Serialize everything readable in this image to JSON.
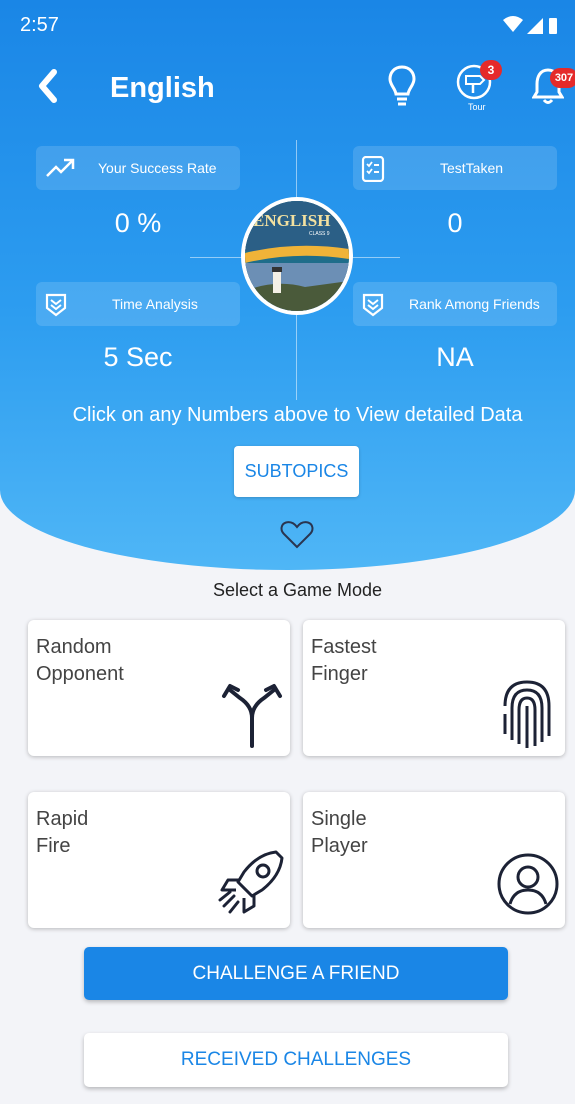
{
  "status": {
    "time": "2:57"
  },
  "header": {
    "title": "English",
    "tour_label": "Tour",
    "tour_badge": "3",
    "notification_badge": "307"
  },
  "stats": {
    "success_rate": {
      "label": "Your Success Rate",
      "value": "0 %"
    },
    "tests_taken": {
      "label": "TestTaken",
      "value": "0"
    },
    "time_analysis": {
      "label": "Time Analysis",
      "value": "5 Sec"
    },
    "rank": {
      "label": "Rank Among Friends",
      "value": "NA"
    }
  },
  "book": {
    "title": "ENGLISH",
    "subtitle": "CLASS 9"
  },
  "hint": "Click on any Numbers above to View detailed Data",
  "subtopics_label": "SUBTOPICS",
  "select_mode_label": "Select a Game Mode",
  "modes": [
    {
      "line1": "Random",
      "line2": "Opponent",
      "icon": "split-arrows-icon"
    },
    {
      "line1": "Fastest",
      "line2": "Finger",
      "icon": "fingerprint-icon"
    },
    {
      "line1": "Rapid",
      "line2": "Fire",
      "icon": "rocket-icon"
    },
    {
      "line1": "Single",
      "line2": "Player",
      "icon": "user-circle-icon"
    }
  ],
  "challenge_label": "CHALLENGE A FRIEND",
  "received_label": "RECEIVED CHALLENGES",
  "colors": {
    "primary": "#1a86e6",
    "badge": "#e52a2a",
    "background": "#f3f4f8"
  }
}
